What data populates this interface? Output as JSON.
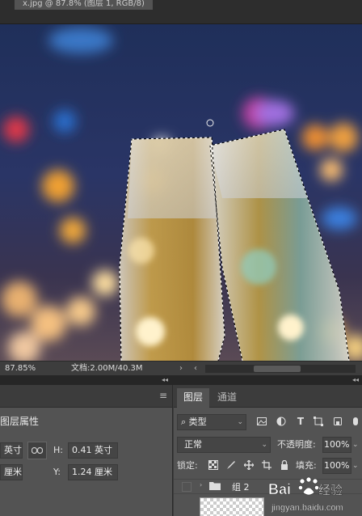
{
  "document": {
    "tab_title": "x.jpg @ 87.8% (图层 1, RGB/8)"
  },
  "status_bar": {
    "zoom": "87.85%",
    "doc_size": "文档:2.00M/40.3M",
    "arrow": "›",
    "scroll_left": "‹"
  },
  "collapse": {
    "left": "◂◂",
    "right": "◂◂"
  },
  "properties_panel": {
    "menu_icon": "≡",
    "title": "图层属性",
    "w_value": "英寸",
    "h_label": "H:",
    "h_value": "0.41 英寸",
    "x_value": "厘米",
    "y_label": "Y:",
    "y_value": "1.24 厘米"
  },
  "layers_panel": {
    "tabs": [
      {
        "label": "图层"
      },
      {
        "label": "通道"
      }
    ],
    "filter_kind": "类型",
    "blend_mode": "正常",
    "opacity_label": "不透明度:",
    "opacity_value": "100%",
    "lock_label": "锁定:",
    "fill_label": "填充:",
    "fill_value": "100%",
    "layers": [
      {
        "name": "组 2"
      }
    ]
  },
  "watermark": {
    "brand": "Bai",
    "brand2": "经验",
    "url": "jingyan.baidu.com"
  },
  "icons": [
    "search-icon",
    "image-filter-icon",
    "adjustment-filter-icon",
    "type-filter-icon",
    "shape-filter-icon",
    "smart-object-filter-icon",
    "link-icon",
    "lock-transparent-icon",
    "lock-image-icon",
    "lock-position-icon",
    "lock-artboard-icon",
    "lock-all-icon",
    "folder-icon",
    "eye-icon"
  ]
}
